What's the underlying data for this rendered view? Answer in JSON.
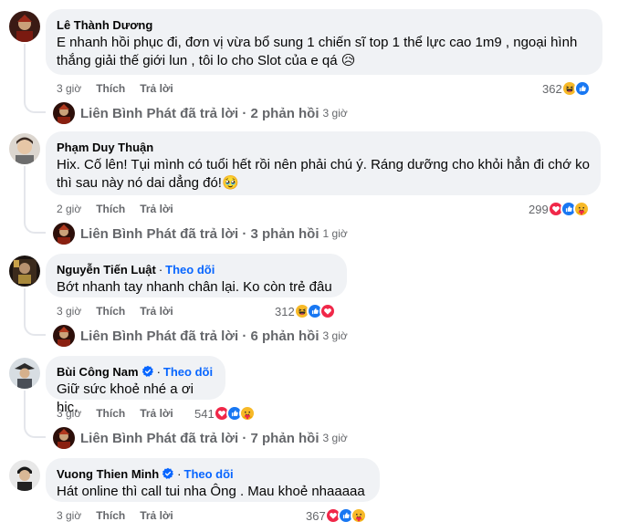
{
  "actions": {
    "like": "Thích",
    "reply": "Trả lời"
  },
  "comments": [
    {
      "author": "Lê Thành Dương",
      "text": "E nhanh hồi phục đi, đơn vị vừa bổ sung 1 chiến sĩ top 1 thể lực cao 1m9 , ngoại hình thắng giải thế giới lun , tôi lo cho Slot của e qá 😥",
      "time": "3 giờ",
      "reaction_count": "362",
      "reactions": [
        "haha",
        "like"
      ],
      "reply_summary": "Liên Bình Phát đã trả lời · 2 phản hồi",
      "reply_time": "3 giờ"
    },
    {
      "author": "Phạm Duy Thuận",
      "text": "Hix. Cố lên! Tụi mình có tuổi hết rồi nên phải chú ý. Ráng dưỡng cho khỏi hẳn đi chớ ko thì sau này nó dai dẳng đó!🥹",
      "time": "2 giờ",
      "reaction_count": "299",
      "reactions": [
        "love",
        "like",
        "care"
      ],
      "reply_summary": "Liên Bình Phát đã trả lời · 3 phản hồi",
      "reply_time": "1 giờ"
    },
    {
      "author": "Nguyễn Tiến Luật",
      "follow": "Theo dõi",
      "text": "Bớt nhanh tay nhanh chân lại. Ko còn trẻ đâu",
      "time": "3 giờ",
      "reaction_count": "312",
      "reactions": [
        "haha",
        "like",
        "love"
      ],
      "reply_summary": "Liên Bình Phát đã trả lời · 6 phản hồi",
      "reply_time": "3 giờ"
    },
    {
      "author": "Bùi Công Nam",
      "follow": "Theo dõi",
      "text": "Giữ sức khoẻ nhé a ơi hic.",
      "time": "3 giờ",
      "reaction_count": "541",
      "reactions": [
        "love",
        "like",
        "care"
      ],
      "reply_summary": "Liên Bình Phát đã trả lời · 7 phản hồi",
      "reply_time": "3 giờ"
    },
    {
      "author": "Vuong Thien Minh",
      "follow": "Theo dõi",
      "text": "Hát online thì call tui nha Ông . Mau khoẻ nhaaaaa",
      "time": "3 giờ",
      "reaction_count": "367",
      "reactions": [
        "love",
        "like",
        "care"
      ]
    }
  ],
  "colors": {
    "link": "#0866ff",
    "meta": "#65676b",
    "bubble": "#f0f2f5",
    "love": "#f02849",
    "like": "#0866ff",
    "haha": "#f7b928"
  }
}
